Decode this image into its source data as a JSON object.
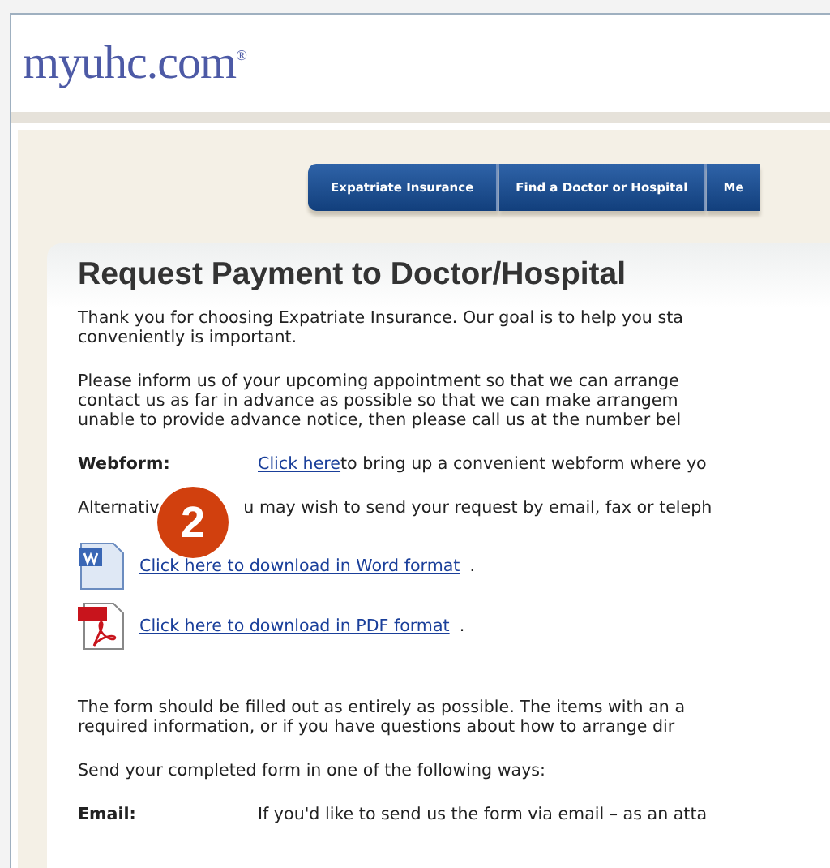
{
  "logo": {
    "text": "myuhc.com",
    "mark": "®"
  },
  "nav_tabs": [
    {
      "label": "Expatriate Insurance"
    },
    {
      "label": "Find a Doctor or Hospital"
    },
    {
      "label": "Me"
    }
  ],
  "title": "Request Payment to Doctor/Hospital",
  "intro": [
    [
      "Thank you for choosing Expatriate Insurance. Our goal is to help you sta",
      "conveniently is important."
    ],
    [
      "Please inform us of your upcoming appointment so that we can arrange",
      "contact us as far in advance as possible so that we can make arrangem",
      "unable to provide advance notice, then please call us at the number bel"
    ]
  ],
  "webform": {
    "label": "Webform:",
    "link": "Click here",
    "text": " to bring up a convenient webform where yo"
  },
  "alternative": {
    "before": "Alternativ",
    "after": "u may wish to send your request by email, fax or teleph"
  },
  "badge": "2",
  "downloads": [
    {
      "kind": "word",
      "link": "Click here to download in Word format",
      "after": "."
    },
    {
      "kind": "pdf",
      "link": "Click here to download in PDF format",
      "after": "."
    }
  ],
  "instructions": [
    [
      "The form should be filled out as entirely as possible. The items with an a",
      "required information, or if you have questions about how to arrange dir"
    ],
    [
      "Send your completed form in one of the following ways:"
    ]
  ],
  "methods": [
    {
      "label": "Email:",
      "text": "If you'd like to send us the form via email – as an atta"
    }
  ]
}
